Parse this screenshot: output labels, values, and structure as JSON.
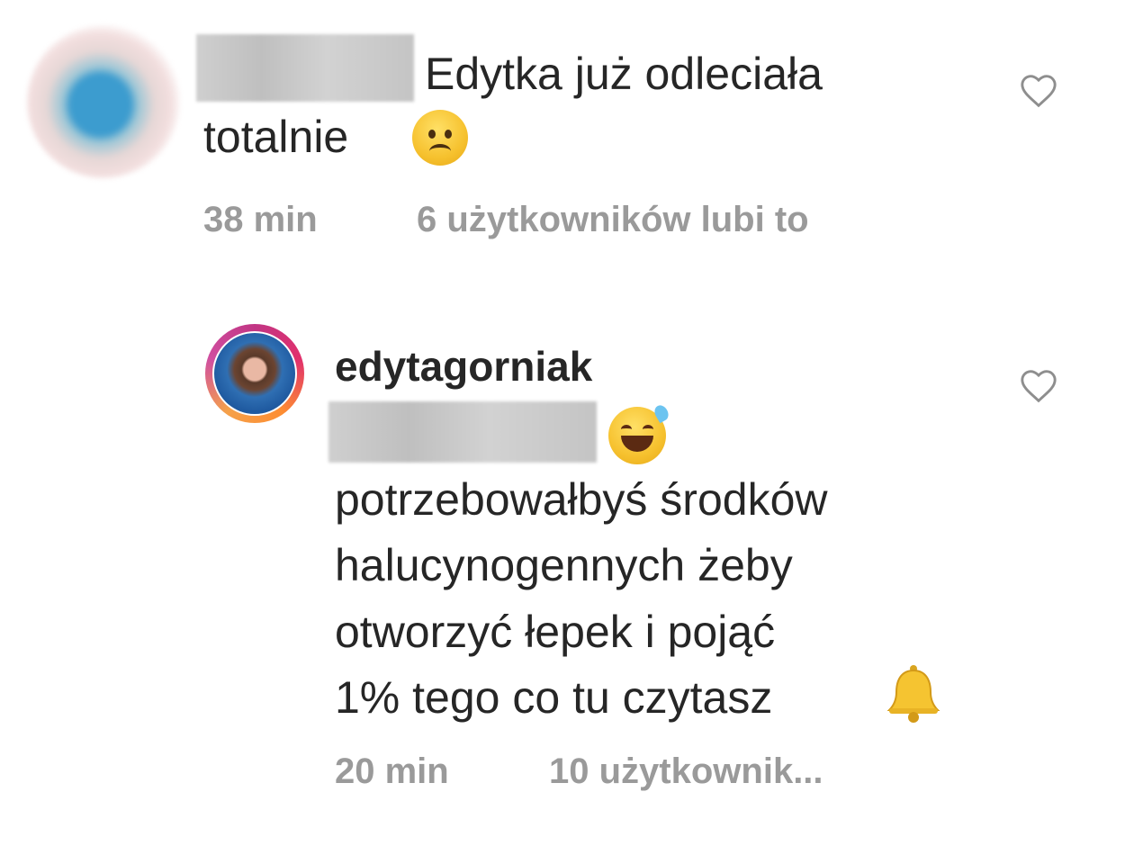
{
  "comments": [
    {
      "text_line1": "Edytka już odleciała",
      "text_line2": "totalnie",
      "emoji": "worried-face-emoji",
      "time": "38 min",
      "likes": "6 użytkowników lubi to",
      "heart_icon": "heart-outline-icon"
    },
    {
      "username": "edytagorniak",
      "emoji": "grinning-sweat-emoji",
      "lines": [
        "potrzebowałbyś środków",
        "halucynogennych żeby",
        "otworzyć łepek i pojąć",
        "1% tego co tu czytasz"
      ],
      "trailing_emoji": "bell-emoji",
      "time": "20 min",
      "likes": "10 użytkownik...",
      "heart_icon": "heart-outline-icon"
    }
  ],
  "colors": {
    "text": "#262626",
    "meta": "#9a9a9a",
    "background": "#ffffff"
  }
}
